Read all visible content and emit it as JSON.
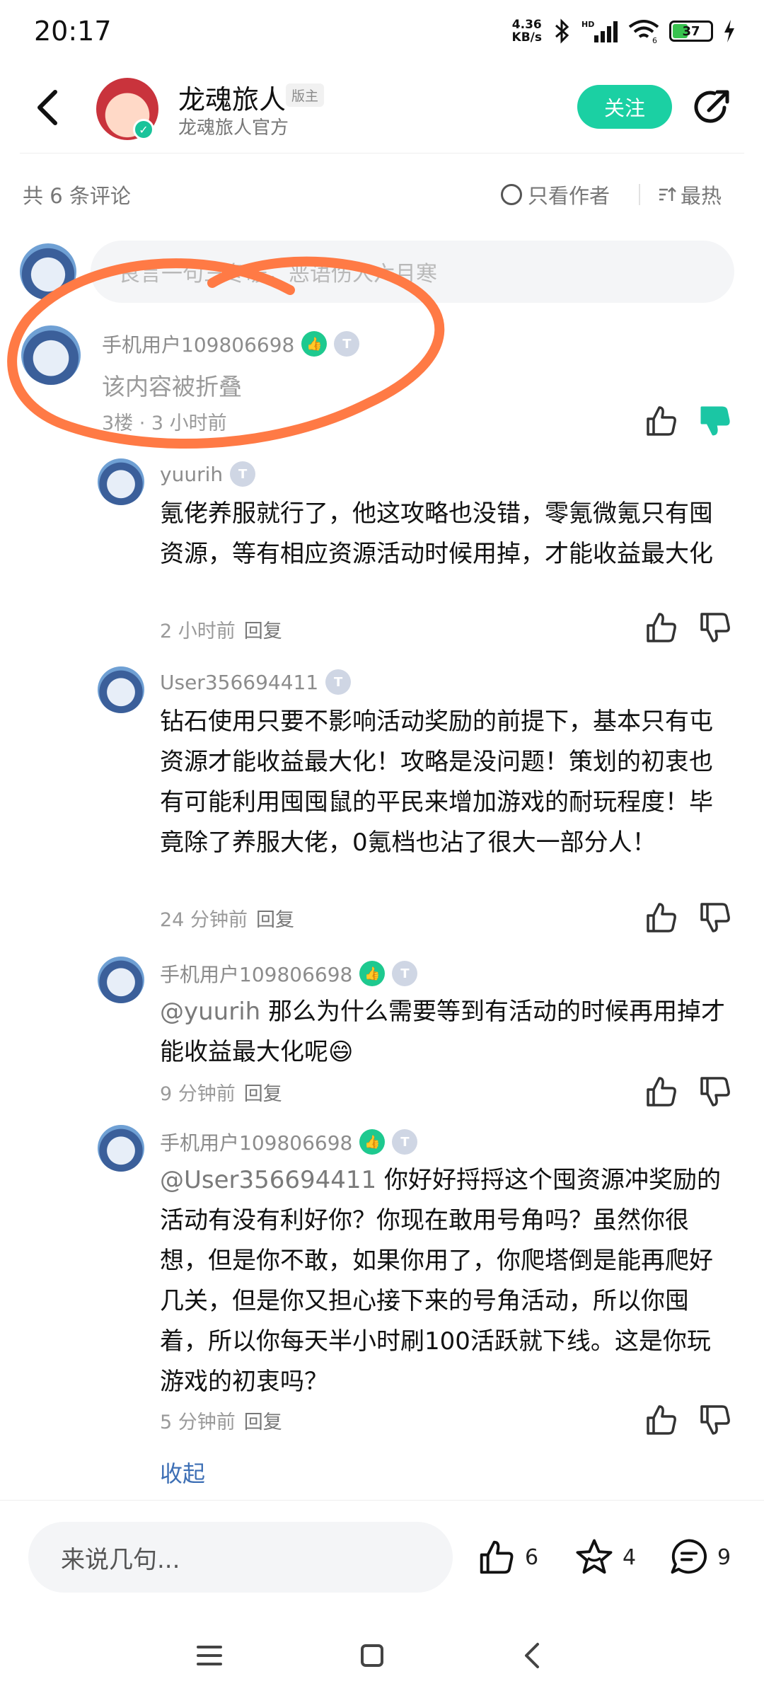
{
  "status": {
    "time": "20:17",
    "net_speed_top": "4.36",
    "net_speed_unit": "KB/s",
    "hd": "HD",
    "wifi_index": "6",
    "battery": "37"
  },
  "header": {
    "name": "龙魂旅人",
    "badge": "版主",
    "subtitle": "龙魂旅人官方",
    "follow_label": "关注"
  },
  "filter": {
    "count": "共 6 条评论",
    "only_author": "只看作者",
    "sort": "最热"
  },
  "input": {
    "placeholder": "良言一句三冬暖，恶语伤人六月寒"
  },
  "main_comment": {
    "user": "手机用户109806698",
    "level": "T",
    "text": "该内容被折叠",
    "meta": "3楼 · 3 小时前"
  },
  "replies": [
    {
      "user": "yuurih",
      "level": "T",
      "mention": "",
      "text": "氪佬养服就行了，他这攻略也没错，零氪微氪只有囤资源，等有相应资源活动时候用掉，才能收益最大化",
      "time": "2 小时前",
      "reply": "回复"
    },
    {
      "user": "User356694411",
      "level": "T",
      "mention": "",
      "text": "钻石使用只要不影响活动奖励的前提下，基本只有屯资源才能收益最大化！攻略是没问题！策划的初衷也有可能利用囤囤鼠的平民来增加游戏的耐玩程度！毕竟除了养服大佬，0氪档也沾了很大一部分人！",
      "time": "24 分钟前",
      "reply": "回复"
    },
    {
      "user": "手机用户109806698",
      "level": "T",
      "mention": "@yuurih",
      "text": "那么为什么需要等到有活动的时候再用掉才能收益最大化呢😄",
      "time": "9 分钟前",
      "reply": "回复"
    },
    {
      "user": "手机用户109806698",
      "level": "T",
      "mention": "@User356694411",
      "text": "你好好捋捋这个囤资源冲奖励的活动有没有利好你？你现在敢用号角吗？虽然你很想，但是你不敢，如果你用了，你爬塔倒是能再爬好几关，但是你又担心接下来的号角活动，所以你囤着，所以你每天半小时刷100活跃就下线。这是你玩游戏的初衷吗？",
      "time": "5 分钟前",
      "reply": "回复"
    }
  ],
  "collapse_label": "收起",
  "bottom": {
    "say_placeholder": "来说几句...",
    "likes": "6",
    "stars": "4",
    "comments": "9"
  },
  "colors": {
    "accent": "#1bd0a3",
    "link": "#3d6fb5",
    "annotation": "#ff7a45"
  }
}
